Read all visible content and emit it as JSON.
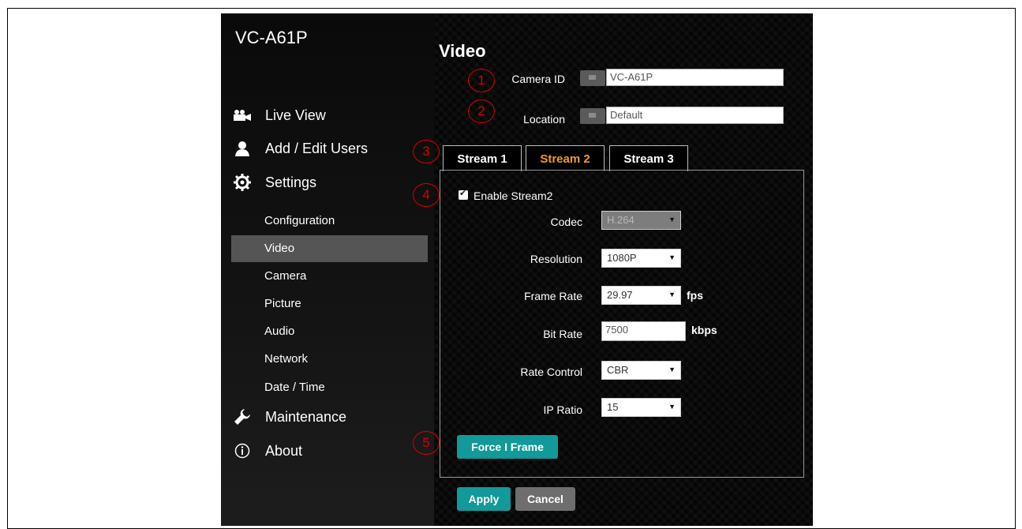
{
  "app": {
    "title": "VC-A61P"
  },
  "sidebar": {
    "main_items": [
      {
        "label": "Live View",
        "icon": "camera-icon"
      },
      {
        "label": "Add / Edit Users",
        "icon": "user-icon"
      },
      {
        "label": "Settings",
        "icon": "gear-icon"
      },
      {
        "label": "Maintenance",
        "icon": "wrench-icon"
      },
      {
        "label": "About",
        "icon": "info-icon"
      }
    ],
    "sub_items": [
      "Configuration",
      "Video",
      "Camera",
      "Picture",
      "Audio",
      "Network",
      "Date / Time"
    ],
    "active_sub_item": "Video"
  },
  "page": {
    "title": "Video"
  },
  "camera_id": {
    "label": "Camera ID",
    "value": "VC-A61P"
  },
  "location": {
    "label": "Location",
    "value": "Default"
  },
  "tabs": [
    {
      "label": "Stream 1",
      "active": false
    },
    {
      "label": "Stream 2",
      "active": true
    },
    {
      "label": "Stream 3",
      "active": false
    }
  ],
  "stream": {
    "enable_label": "Enable Stream2",
    "enabled": true,
    "codec": {
      "label": "Codec",
      "value": "H.264",
      "disabled": true
    },
    "resolution": {
      "label": "Resolution",
      "value": "1080P"
    },
    "frame_rate": {
      "label": "Frame Rate",
      "value": "29.97",
      "unit": "fps"
    },
    "bit_rate": {
      "label": "Bit Rate",
      "value": "7500",
      "unit": "kbps"
    },
    "rate_control": {
      "label": "Rate Control",
      "value": "CBR"
    },
    "ip_ratio": {
      "label": "IP Ratio",
      "value": "15"
    },
    "force_button": "Force I Frame"
  },
  "actions": {
    "apply": "Apply",
    "cancel": "Cancel"
  },
  "callouts": [
    "1",
    "2",
    "3",
    "4",
    "5"
  ],
  "colors": {
    "accent_teal": "#12999a",
    "active_tab": "#f39a1f",
    "callout_red": "#d60000",
    "active_nav_bg": "#555555"
  }
}
